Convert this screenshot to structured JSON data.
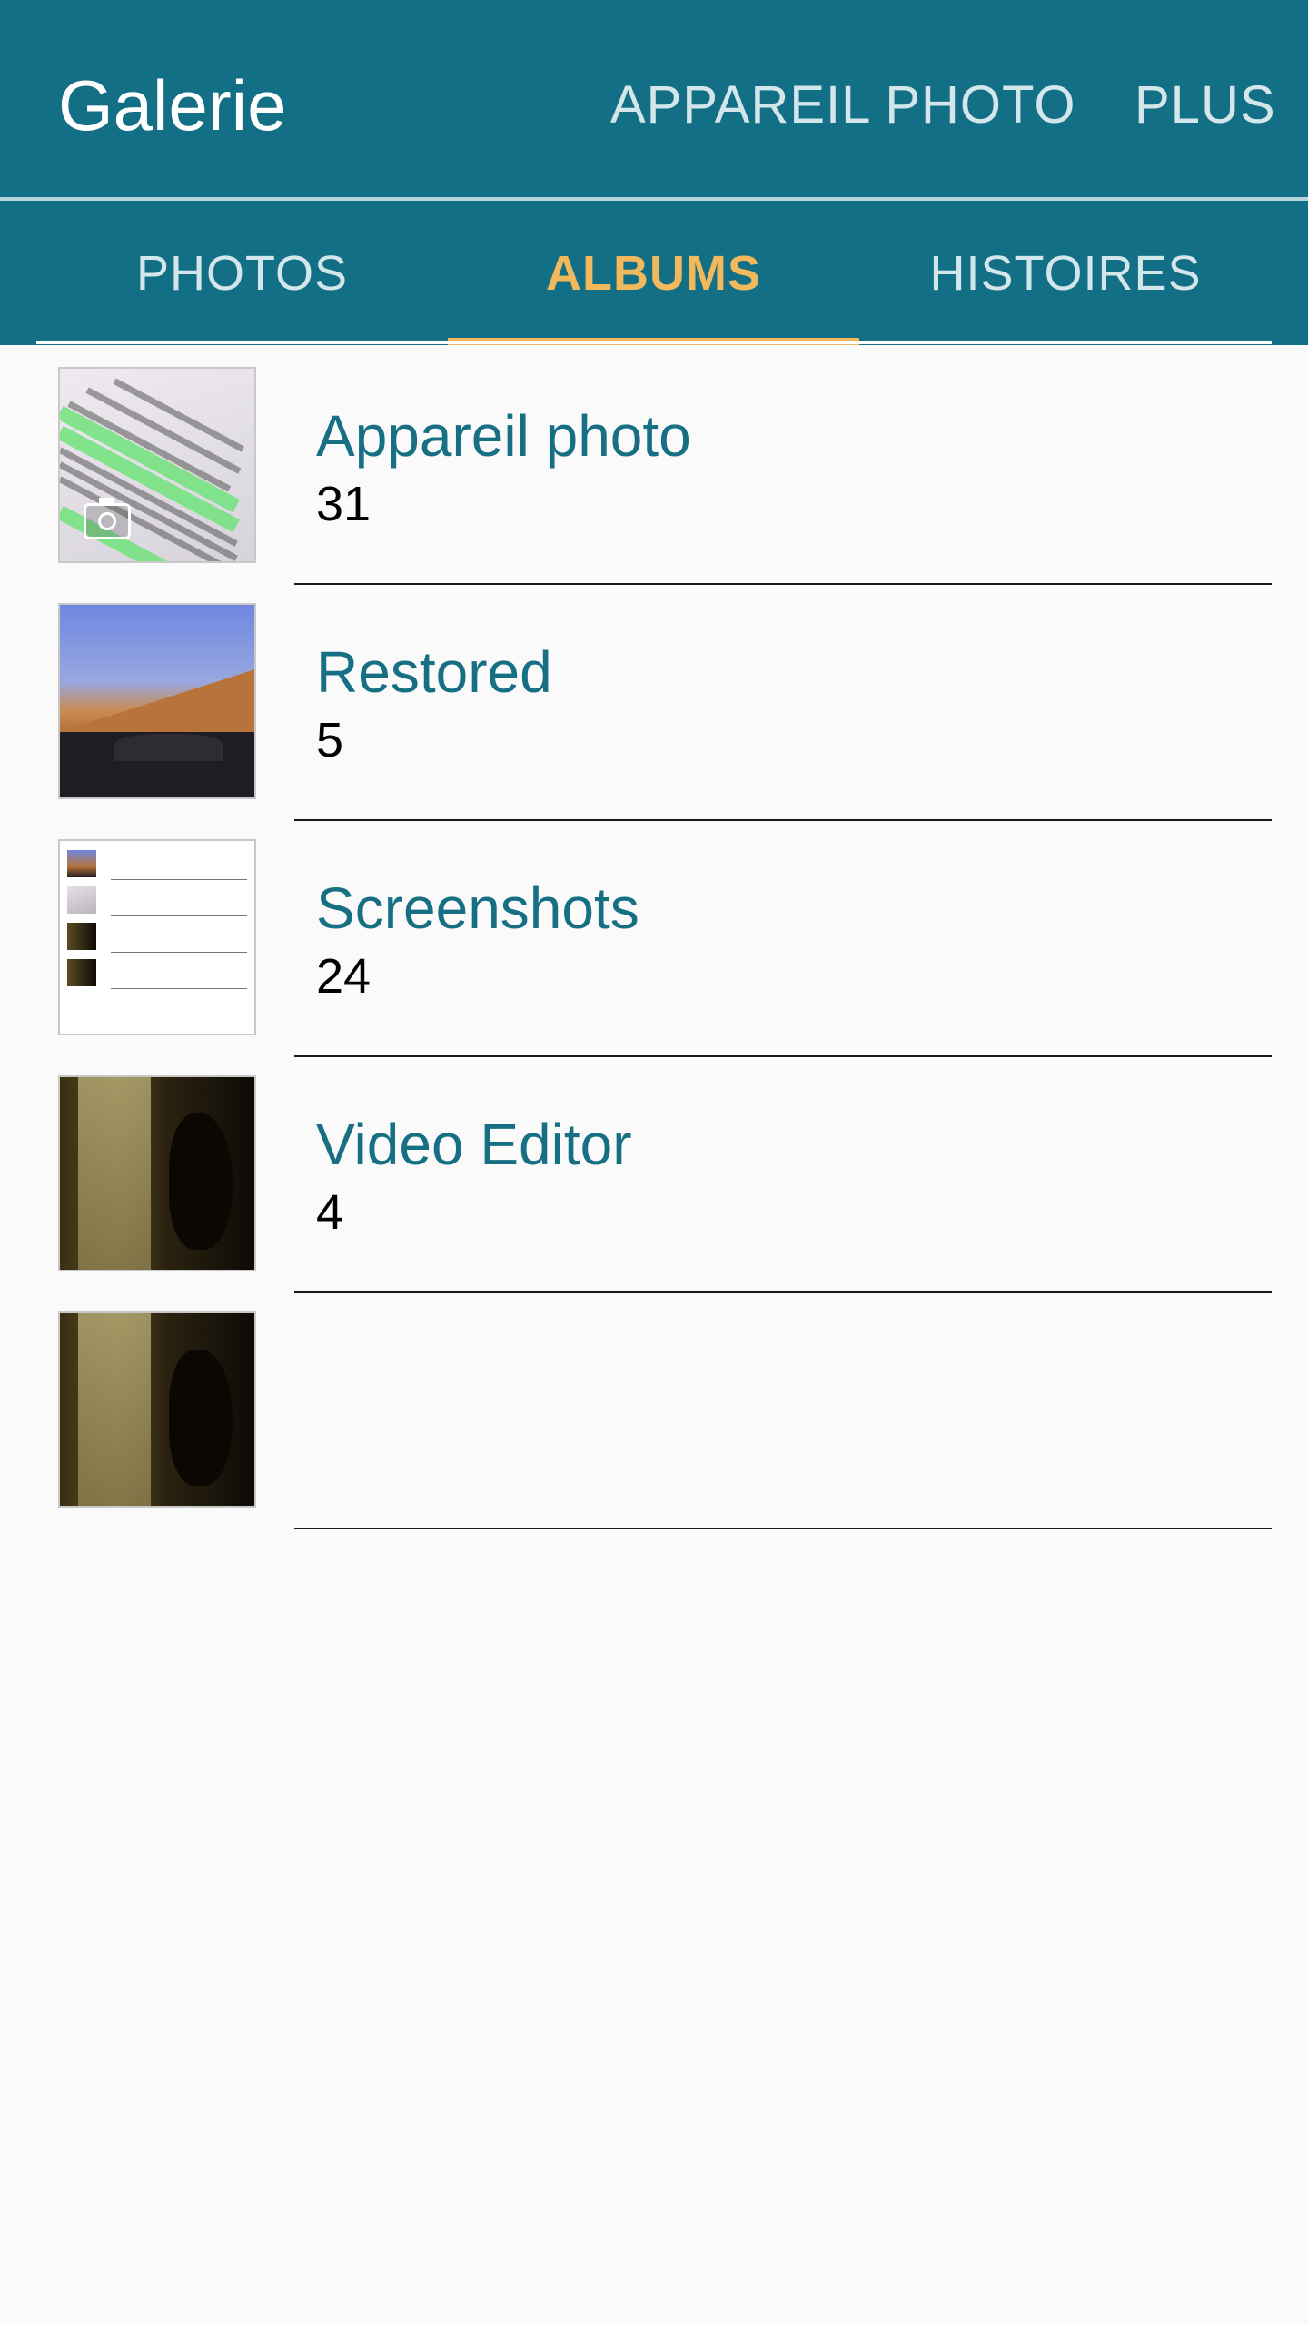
{
  "appbar": {
    "title": "Galerie",
    "actions": [
      "APPAREIL PHOTO",
      "PLUS"
    ],
    "color": "#136f85"
  },
  "tabs": [
    {
      "label": "PHOTOS",
      "selected": false
    },
    {
      "label": "ALBUMS",
      "selected": true
    },
    {
      "label": "HISTOIRES",
      "selected": false
    }
  ],
  "accent": "#f2b85c",
  "albums": [
    {
      "name": "Appareil photo",
      "count": "31",
      "thumb": "document-photo",
      "icon": "camera-icon"
    },
    {
      "name": "Restored",
      "count": "5",
      "thumb": "mountain-photo"
    },
    {
      "name": "Screenshots",
      "count": "24",
      "thumb": "screenshot"
    },
    {
      "name": "Video Editor",
      "count": "4",
      "thumb": "dark-video-frame"
    },
    {
      "name": "",
      "count": "",
      "thumb": "dark-video-frame"
    }
  ]
}
